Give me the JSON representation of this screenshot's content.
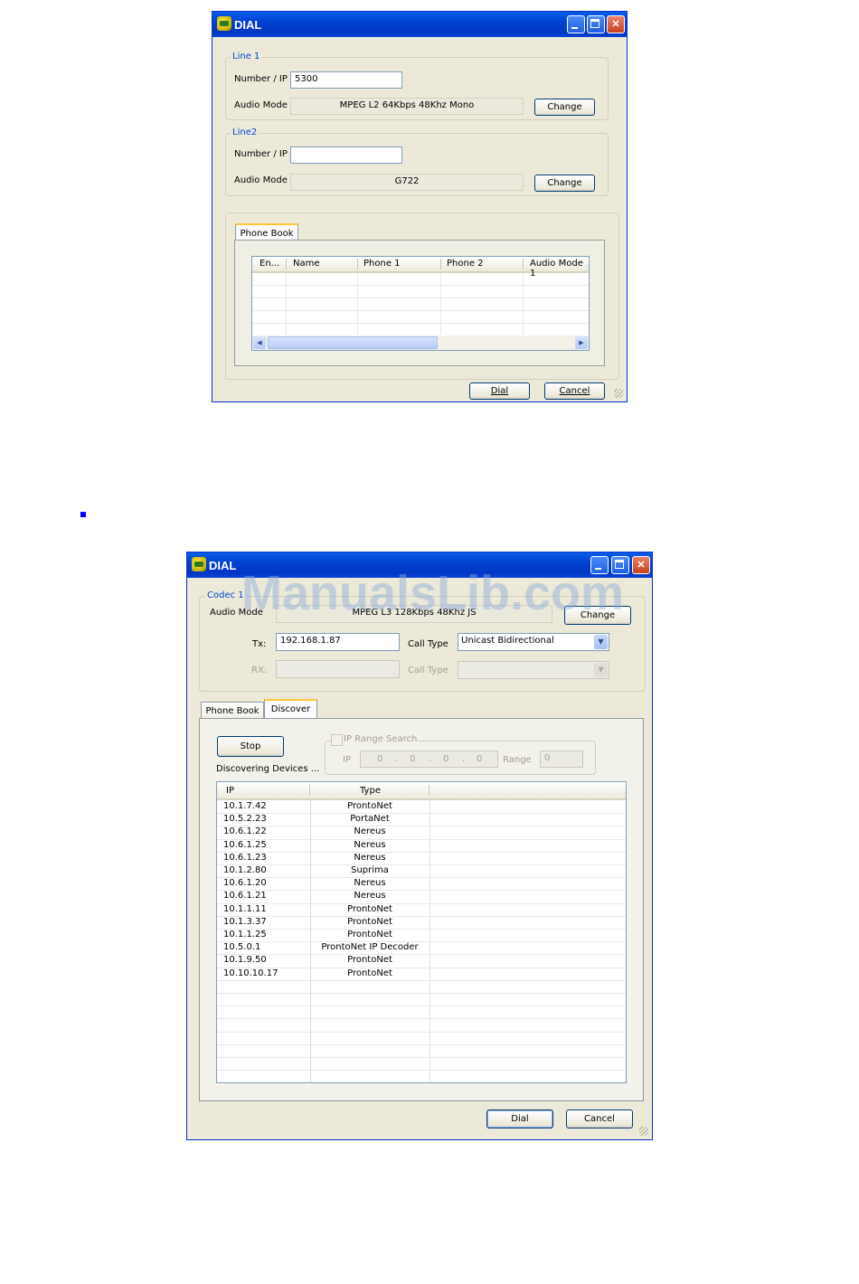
{
  "dialog1": {
    "title": "DIAL",
    "line1": {
      "legend": "Line 1",
      "number_label": "Number / IP",
      "number_value": "5300",
      "audio_label": "Audio Mode",
      "audio_value": "MPEG L2 64Kbps 48Khz Mono",
      "change_label": "Change"
    },
    "line2": {
      "legend": "Line2",
      "number_label": "Number / IP",
      "number_value": "",
      "audio_label": "Audio Mode",
      "audio_value": "G722",
      "change_label": "Change"
    },
    "tab_phonebook": "Phone Book",
    "grid_columns": [
      "En...",
      "Name",
      "Phone 1",
      "Phone 2",
      "Audio Mode 1"
    ],
    "dial_label": "Dial",
    "cancel_label": "Cancel"
  },
  "dialog2": {
    "watermark": "ManualsLib.com",
    "title": "DIAL",
    "codec": {
      "legend": "Codec 1",
      "audio_label": "Audio Mode",
      "audio_value": "MPEG L3 128Kbps 48Khz JS",
      "change_label": "Change",
      "tx_label": "Tx:",
      "tx_value": "192.168.1.87",
      "call_type_label": "Call Type",
      "call_type_value": "Unicast Bidirectional",
      "rx_label": "RX:",
      "rx_value": "",
      "call_type2_label": "Call Type",
      "call_type2_value": ""
    },
    "tabs": [
      "Phone Book",
      "Discover"
    ],
    "stop_label": "Stop",
    "status_text": "Discovering Devices ...",
    "ip_range": {
      "label": "IP Range Search",
      "checked": false,
      "ip_label": "IP",
      "ip_octets": [
        "0",
        "0",
        "0",
        "0"
      ],
      "range_label": "Range",
      "range_value": "0"
    },
    "list_columns": [
      "IP",
      "Type"
    ],
    "devices": [
      {
        "ip": "10.1.7.42",
        "type": "ProntoNet"
      },
      {
        "ip": "10.5.2.23",
        "type": "PortaNet"
      },
      {
        "ip": "10.6.1.22",
        "type": "Nereus"
      },
      {
        "ip": "10.6.1.25",
        "type": "Nereus"
      },
      {
        "ip": "10.6.1.23",
        "type": "Nereus"
      },
      {
        "ip": "10.1.2.80",
        "type": "Suprima"
      },
      {
        "ip": "10.6.1.20",
        "type": "Nereus"
      },
      {
        "ip": "10.6.1.21",
        "type": "Nereus"
      },
      {
        "ip": "10.1.1.11",
        "type": "ProntoNet"
      },
      {
        "ip": "10.1.3.37",
        "type": "ProntoNet"
      },
      {
        "ip": "10.1.1.25",
        "type": "ProntoNet"
      },
      {
        "ip": "10.5.0.1",
        "type": "ProntoNet IP Decoder"
      },
      {
        "ip": "10.1.9.50",
        "type": "ProntoNet"
      },
      {
        "ip": "10.10.10.17",
        "type": "ProntoNet"
      }
    ],
    "dial_label": "Dial",
    "cancel_label": "Cancel"
  }
}
